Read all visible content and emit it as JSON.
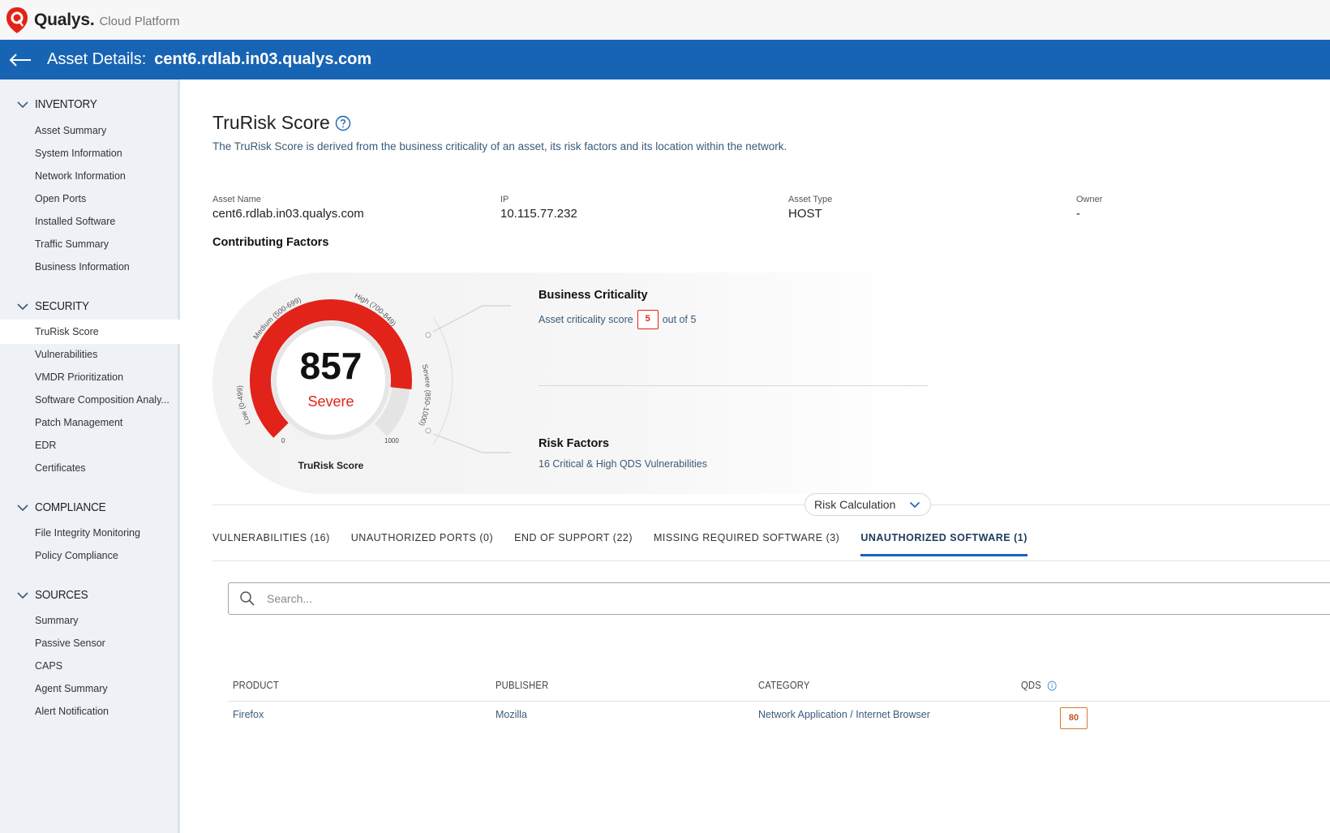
{
  "topbar": {
    "brand": "Qualys.",
    "brand_sub": "Cloud Platform",
    "colors": {
      "logo": "#e2231a"
    }
  },
  "titlebar": {
    "label": "Asset Details:",
    "value": "cent6.rdlab.in03.qualys.com",
    "color": "#1864b4"
  },
  "sidebar": {
    "sections": [
      {
        "label": "INVENTORY",
        "items": [
          "Asset Summary",
          "System Information",
          "Network Information",
          "Open Ports",
          "Installed Software",
          "Traffic Summary",
          "Business Information"
        ]
      },
      {
        "label": "SECURITY",
        "items": [
          "TruRisk Score",
          "Vulnerabilities",
          "VMDR Prioritization",
          "Software Composition Analy...",
          "Patch Management",
          "EDR",
          "Certificates"
        ]
      },
      {
        "label": "COMPLIANCE",
        "items": [
          "File Integrity Monitoring",
          "Policy Compliance"
        ]
      },
      {
        "label": "SOURCES",
        "items": [
          "Summary",
          "Passive Sensor",
          "CAPS",
          "Agent Summary",
          "Alert Notification"
        ]
      }
    ],
    "active_item": "TruRisk Score"
  },
  "main": {
    "title": "TruRisk Score",
    "description": "The TruRisk Score is derived from the business criticality of an asset, its risk factors and its location within the network.",
    "meta": {
      "asset_name_label": "Asset Name",
      "asset_name": "cent6.rdlab.in03.qualys.com",
      "ip_label": "IP",
      "ip": "10.115.77.232",
      "asset_type_label": "Asset Type",
      "asset_type": "HOST",
      "owner_label": "Owner",
      "owner": "-"
    },
    "contributing_factors": "Contributing Factors",
    "gauge": {
      "score": "857",
      "severity": "Severe",
      "caption": "TruRisk Score",
      "min": 0,
      "max": 1000,
      "value": 857,
      "min_label": "0",
      "max_label": "1000",
      "bands": [
        {
          "label": "Low (0-499)",
          "from": 0,
          "to": 499
        },
        {
          "label": "Medium (500-699)",
          "from": 500,
          "to": 699
        },
        {
          "label": "High (700-849)",
          "from": 700,
          "to": 849
        },
        {
          "label": "Severe (850-1000)",
          "from": 850,
          "to": 1000
        }
      ],
      "colors": {
        "fill": "#e2231a",
        "track": "#e4e4e4"
      }
    },
    "business_criticality": {
      "title": "Business Criticality",
      "prefix": "Asset criticality score",
      "score": "5",
      "suffix": "out of 5"
    },
    "risk_factors": {
      "title": "Risk Factors",
      "text": "16 Critical & High QDS Vulnerabilities"
    },
    "risk_calculation": "Risk Calculation",
    "tabs": [
      {
        "label": "VULNERABILITIES (16)",
        "active": false
      },
      {
        "label": "UNAUTHORIZED PORTS (0)",
        "active": false
      },
      {
        "label": "END OF SUPPORT (22)",
        "active": false
      },
      {
        "label": "MISSING REQUIRED SOFTWARE (3)",
        "active": false
      },
      {
        "label": "UNAUTHORIZED SOFTWARE (1)",
        "active": true
      }
    ],
    "search": {
      "placeholder": "Search..."
    },
    "table": {
      "headers": [
        "PRODUCT",
        "PUBLISHER",
        "CATEGORY",
        "QDS"
      ],
      "rows": [
        {
          "product": "Firefox",
          "publisher": "Mozilla",
          "category": "Network Application / Internet Browser",
          "qds": "80"
        }
      ]
    }
  }
}
